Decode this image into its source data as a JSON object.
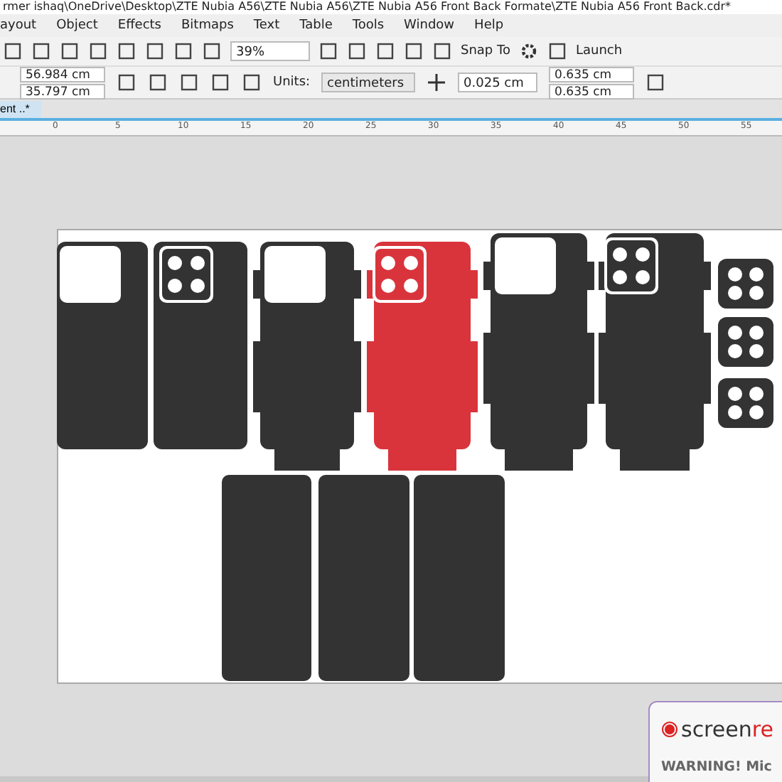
{
  "window": {
    "title": "rmer ishaq\\OneDrive\\Desktop\\ZTE Nubia A56\\ZTE Nubia A56\\ZTE Nubia A56 Front Back Formate\\ZTE Nubia A56 Front Back.cdr*"
  },
  "menu": [
    "ayout",
    "Object",
    "Effects",
    "Bitmaps",
    "Text",
    "Table",
    "Tools",
    "Window",
    "Help"
  ],
  "toolbar": {
    "zoom": "39%",
    "snap": "Snap To",
    "launch": "Launch"
  },
  "property_bar": {
    "width": "56.984 cm",
    "height": "35.797 cm",
    "units_label": "Units:",
    "units": "centimeters",
    "nudge": "0.025 cm",
    "dup_x": "0.635 cm",
    "dup_y": "0.635 cm"
  },
  "tabs": [
    {
      "label": "ent ..*",
      "selected": true
    }
  ],
  "ruler": [
    "0",
    "5",
    "10",
    "15",
    "20",
    "25",
    "30",
    "35",
    "40",
    "45",
    "50",
    "55"
  ],
  "shapes": [
    {
      "kind": "back-plain",
      "color": "#333333"
    },
    {
      "kind": "back-camera",
      "color": "#333333"
    },
    {
      "kind": "back-plain",
      "color": "#333333"
    },
    {
      "kind": "back-camera",
      "color": "#d9343c"
    },
    {
      "kind": "back-plain",
      "color": "#333333"
    },
    {
      "kind": "back-camera",
      "color": "#333333"
    },
    {
      "kind": "lens",
      "color": "#333333"
    },
    {
      "kind": "lens",
      "color": "#333333"
    },
    {
      "kind": "lens",
      "color": "#333333"
    },
    {
      "kind": "front",
      "color": "#333333"
    },
    {
      "kind": "front",
      "color": "#333333"
    },
    {
      "kind": "front",
      "color": "#333333"
    }
  ],
  "popup": {
    "brand_start": "screen",
    "brand_end": "re",
    "warning": "WARNING! Mic"
  }
}
